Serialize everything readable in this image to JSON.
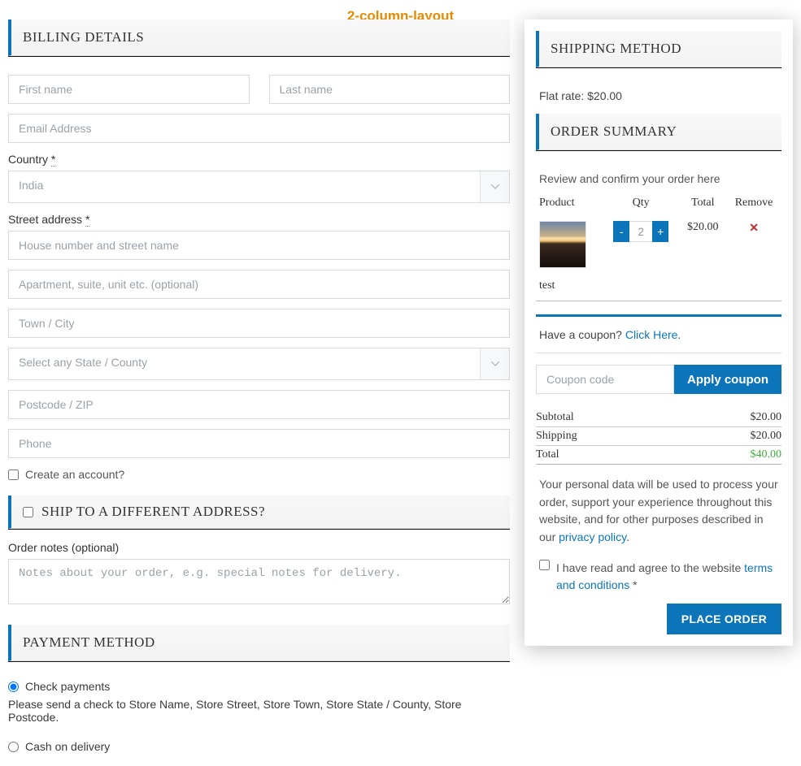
{
  "layout_label": "2-column-layout",
  "billing": {
    "heading": "BILLING DETAILS",
    "first_name_ph": "First name",
    "last_name_ph": "Last name",
    "email_ph": "Email Address",
    "country_label": "Country ",
    "country_value": "India",
    "street_label": "Street address ",
    "street1_ph": "House number and street name",
    "street2_ph": "Apartment, suite, unit etc. (optional)",
    "city_ph": "Town / City",
    "state_ph": "Select any State / County",
    "postcode_ph": "Postcode / ZIP",
    "phone_ph": "Phone",
    "create_account_label": "Create an account?"
  },
  "ship_diff": {
    "label": "SHIP TO A DIFFERENT ADDRESS?"
  },
  "order_notes": {
    "label": "Order notes (optional)",
    "ph": "Notes about your order, e.g. special notes for delivery."
  },
  "payment": {
    "heading": "PAYMENT METHOD",
    "options": [
      {
        "label": "Check payments",
        "selected": true,
        "desc": "Please send a check to Store Name, Store Street, Store Town, Store State / County, Store Postcode."
      },
      {
        "label": "Cash on delivery",
        "selected": false,
        "desc": ""
      }
    ]
  },
  "shipping_method": {
    "heading": "SHIPPING METHOD",
    "line": "Flat rate: $20.00"
  },
  "order_summary": {
    "heading": "ORDER SUMMARY",
    "review_text": "Review and confirm your order here",
    "columns": {
      "product": "Product",
      "qty": "Qty",
      "total": "Total",
      "remove": "Remove"
    },
    "items": [
      {
        "name": "test",
        "qty": "2",
        "total": "$20.00"
      }
    ],
    "coupon_prompt_text": "Have a coupon? ",
    "coupon_prompt_link": "Click Here.",
    "coupon_ph": "Coupon code",
    "apply_label": "Apply coupon",
    "totals": {
      "subtotal_label": "Subtotal",
      "subtotal_value": "$20.00",
      "shipping_label": "Shipping",
      "shipping_value": "$20.00",
      "total_label": "Total",
      "total_value": "$40.00"
    },
    "privacy_text": "Your personal data will be used to process your order, support your experience throughout this website, and for other purposes described in our ",
    "privacy_link": "privacy policy",
    "agree_prefix": "I have read and agree to the website ",
    "agree_link": "terms and conditions",
    "agree_suffix": " *",
    "place_order_label": "PLACE ORDER"
  }
}
